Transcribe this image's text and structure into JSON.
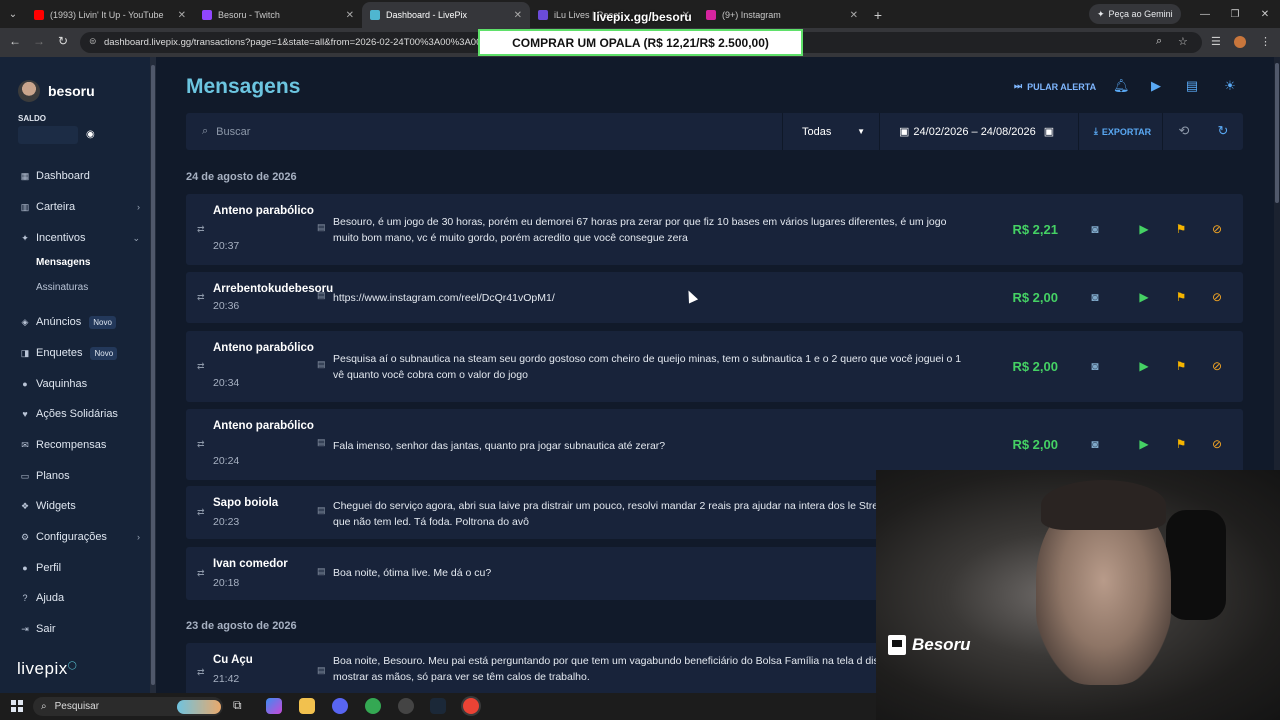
{
  "browser": {
    "tabs": [
      {
        "title": "(1993) Livin' It Up - YouTube",
        "color": "#ff0000",
        "active": false
      },
      {
        "title": "Besoru - Twitch",
        "color": "#9146ff",
        "active": false
      },
      {
        "title": "Dashboard - LivePix",
        "color": "#4fb6d0",
        "active": true
      },
      {
        "title": "iLu Lives | React",
        "color": "#6b4bd8",
        "active": false
      },
      {
        "title": "(9+) Instagram",
        "color": "#d6249f",
        "active": false
      }
    ],
    "gemini_label": "Peça ao Gemini",
    "url": "dashboard.livepix.gg/transactions?page=1&state=all&from=2026-02-24T00%3A00%3A00"
  },
  "stream_overlay": {
    "banner": "COMPRAR UM OPALA (R$ 12,21/R$ 2.500,00)",
    "url": "livepix.gg/besoru",
    "streamer": "Besoru"
  },
  "sidebar": {
    "username": "besoru",
    "saldo_label": "SALDO",
    "items": [
      {
        "label": "Dashboard",
        "icon": "dashboard-icon"
      },
      {
        "label": "Carteira",
        "icon": "wallet-icon",
        "chevron": true
      },
      {
        "label": "Incentivos",
        "icon": "incentives-icon",
        "chevron": true,
        "expanded": true
      },
      {
        "label": "Anúncios",
        "icon": "megaphone-icon",
        "badge": "Novo"
      },
      {
        "label": "Enquetes",
        "icon": "poll-icon",
        "badge": "Novo"
      },
      {
        "label": "Vaquinhas",
        "icon": "piggy-icon"
      },
      {
        "label": "Ações Solidárias",
        "icon": "heart-icon"
      },
      {
        "label": "Recompensas",
        "icon": "gift-icon"
      },
      {
        "label": "Planos",
        "icon": "plans-icon"
      },
      {
        "label": "Widgets",
        "icon": "widgets-icon"
      },
      {
        "label": "Configurações",
        "icon": "gear-icon",
        "chevron": true
      },
      {
        "label": "Perfil",
        "icon": "profile-icon"
      },
      {
        "label": "Ajuda",
        "icon": "help-icon"
      },
      {
        "label": "Sair",
        "icon": "logout-icon"
      }
    ],
    "subitems": [
      {
        "label": "Mensagens",
        "active": true
      },
      {
        "label": "Assinaturas",
        "active": false
      }
    ],
    "logo": "livepix"
  },
  "main": {
    "title": "Mensagens",
    "skip_alert": "PULAR ALERTA",
    "search_placeholder": "Buscar",
    "filter_selected": "Todas",
    "date_range": "24/02/2026 – 24/08/2026",
    "export_label": "EXPORTAR",
    "groups": [
      {
        "date": "24 de agosto de 2026",
        "messages": [
          {
            "name": "Anteno parabólico",
            "time": "20:37",
            "text": "Besouro, é um jogo de 30 horas, porém eu demorei 67 horas pra zerar por que fiz 10 bases em vários lugares diferentes, é um jogo muito bom mano, vc é muito gordo, porém acredito que você consegue zera",
            "amount": "R$ 2,21"
          },
          {
            "name": "Arrebentokudebesoru",
            "time": "20:36",
            "text": "https://www.instagram.com/reel/DcQr41vOpM1/",
            "amount": "R$ 2,00"
          },
          {
            "name": "Anteno parabólico",
            "time": "20:34",
            "text": "Pesquisa aí o subnautica na steam seu gordo gostoso com cheiro de queijo minas, tem o subnautica 1 e o 2 quero que você joguei o 1 vê quanto você cobra com o valor do jogo",
            "amount": "R$ 2,00"
          },
          {
            "name": "Anteno parabólico",
            "time": "20:24",
            "text": "Fala imenso, senhor das jantas, quanto pra jogar subnautica até zerar?",
            "amount": "R$ 2,00"
          },
          {
            "name": "Sapo boiola",
            "time": "20:23",
            "text": "Cheguei do serviço agora, abri sua laive pra distrair um pouco, resolvi mandar 2 reais pra ajudar na intera dos le Streaming geração z, que não tem led. Tá foda. Poltrona do avô",
            "amount": ""
          },
          {
            "name": "Ivan comedor",
            "time": "20:18",
            "text": "Boa noite, ótima live. Me dá o cu?",
            "amount": ""
          }
        ]
      },
      {
        "date": "23 de agosto de 2026",
        "messages": [
          {
            "name": "Cu Açu",
            "time": "21:42",
            "text": "Boa noite, Besouro. Meu pai está perguntando por que tem um vagabundo beneficiário do Bolsa Família na tela d disse para você mostrar as mãos, só para ver se têm calos de trabalho.",
            "amount": ""
          }
        ]
      }
    ]
  },
  "taskbar": {
    "search_label": "Pesquisar"
  }
}
